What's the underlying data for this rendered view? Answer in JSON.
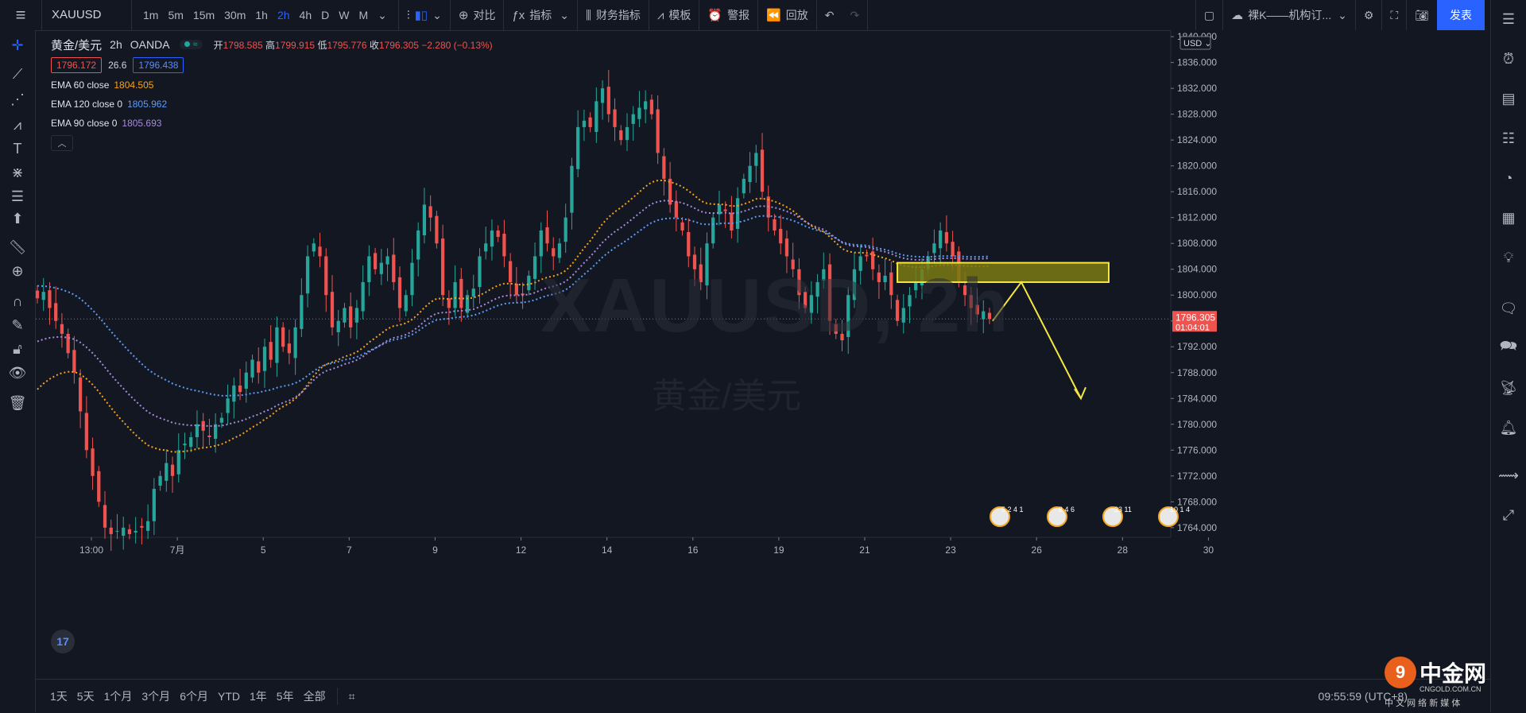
{
  "topbar": {
    "symbol": "XAUUSD",
    "intervals": [
      "1m",
      "5m",
      "15m",
      "30m",
      "1h",
      "2h",
      "4h",
      "D",
      "W",
      "M"
    ],
    "active_interval": "2h",
    "compare_label": "对比",
    "indicators_label": "指标",
    "financials_label": "财务指标",
    "template_label": "模板",
    "alert_label": "警报",
    "replay_label": "回放",
    "layout_name": "裸K——机构订...",
    "publish_label": "发表"
  },
  "legend": {
    "symbol_name": "黄金/美元",
    "interval": "2h",
    "source": "OANDA",
    "open_label": "开",
    "open": "1798.585",
    "high_label": "高",
    "high": "1799.915",
    "low_label": "低",
    "low": "1795.776",
    "close_label": "收",
    "close": "1796.305",
    "change": "−2.280 (−0.13%)",
    "bid": "1796.172",
    "spread": "26.6",
    "ask": "1796.438",
    "emas": [
      {
        "label": "EMA 60 close",
        "value": "1804.505",
        "color": "#f7a21b"
      },
      {
        "label": "EMA 120 close 0",
        "value": "1805.962",
        "color": "#5b9cf6"
      },
      {
        "label": "EMA 90 close 0",
        "value": "1805.693",
        "color": "#a78bdb"
      }
    ]
  },
  "watermark": {
    "ticker": "XAUUSD, 2h",
    "name": "黄金/美元"
  },
  "bottombar": {
    "ranges": [
      "1天",
      "5天",
      "1个月",
      "3个月",
      "6个月",
      "YTD",
      "1年",
      "5年",
      "全部"
    ],
    "clock": "09:55:59 (UTC+8)"
  },
  "brand": {
    "name": "中金网",
    "url": "CNGOLD.COM.CN",
    "tagline": "中 文 网 络 新 媒 体"
  },
  "colors": {
    "up": "#26a69a",
    "down": "#ef5350",
    "bg": "#131722",
    "zone": "#7a7a12",
    "arrow": "#f5e642"
  },
  "chart_data": {
    "type": "candlestick",
    "title": "XAUUSD, 2h",
    "y_axis": {
      "currency": "USD",
      "ylim": [
        1762.5,
        1841
      ],
      "ticks": [
        "1764.000",
        "1768.000",
        "1772.000",
        "1776.000",
        "1780.000",
        "1784.000",
        "1788.000",
        "1792.000",
        "1796.000",
        "1800.000",
        "1804.000",
        "1808.000",
        "1812.000",
        "1816.000",
        "1820.000",
        "1824.000",
        "1828.000",
        "1832.000",
        "1836.000",
        "1840.000"
      ]
    },
    "x_axis": {
      "labels": [
        "13:00",
        "7月",
        "5",
        "7",
        "9",
        "12",
        "14",
        "16",
        "19",
        "21",
        "23",
        "26",
        "28",
        "30"
      ]
    },
    "last_price": {
      "value": "1796.305",
      "countdown": "01:04:01"
    },
    "candle_closes": [
      1799.5,
      1800.5,
      1798,
      1796,
      1794,
      1791,
      1788,
      1782,
      1776,
      1772,
      1768,
      1764,
      1763,
      1763.5,
      1764,
      1763,
      1763.5,
      1764,
      1765,
      1770,
      1772,
      1774,
      1772,
      1776,
      1777,
      1778,
      1780,
      1779,
      1778,
      1780,
      1781,
      1784,
      1786,
      1785,
      1788,
      1790,
      1788,
      1792,
      1790,
      1795,
      1792,
      1791,
      1795,
      1800,
      1806,
      1808,
      1806,
      1800,
      1795,
      1796,
      1798,
      1795,
      1798,
      1802,
      1806,
      1804,
      1805,
      1806,
      1802,
      1798,
      1800,
      1805,
      1810,
      1814,
      1812,
      1808,
      1800,
      1798,
      1802,
      1798,
      1800,
      1801,
      1806,
      1808,
      1810,
      1809,
      1806,
      1802,
      1800,
      1800,
      1803,
      1806,
      1810,
      1808,
      1806,
      1808,
      1812,
      1820,
      1826,
      1827,
      1826,
      1830,
      1832,
      1828,
      1826,
      1824,
      1826,
      1828,
      1829,
      1830,
      1828,
      1822,
      1818,
      1814,
      1812,
      1810,
      1806,
      1804,
      1802,
      1808,
      1812,
      1814,
      1813,
      1810,
      1815,
      1818,
      1820,
      1822,
      1816,
      1812,
      1810,
      1808,
      1806,
      1804,
      1800,
      1798,
      1800,
      1802,
      1804,
      1796,
      1794,
      1793,
      1800,
      1804,
      1806,
      1806,
      1804,
      1802,
      1803,
      1800,
      1796,
      1798,
      1800,
      1802,
      1804,
      1806,
      1808,
      1810,
      1808,
      1806,
      1802,
      1800,
      1798,
      1797,
      1797.5,
      1796.3
    ],
    "emas": [
      {
        "name": "EMA 60 close",
        "color": "#f7a21b",
        "ends": [
          1784.5,
          1804.5
        ]
      },
      {
        "name": "EMA 120 close 0",
        "color": "#5b9cf6",
        "ends": [
          1801.5,
          1806
        ]
      },
      {
        "name": "EMA 90 close 0",
        "color": "#a78bdb",
        "ends": [
          1792.5,
          1805.7
        ]
      }
    ],
    "annotations": [
      {
        "type": "rectangle",
        "y_range": [
          1802,
          1805
        ],
        "color": "#7a7a12",
        "border": "#f5e642"
      },
      {
        "type": "arrow",
        "points": [
          [
            1796,
            0
          ],
          [
            1802,
            1
          ],
          [
            1784,
            2
          ]
        ],
        "color": "#f5e642"
      }
    ],
    "event_markers": [
      "5 2 4 1",
      "8 4 6",
      "33 11",
      "10 1 4"
    ]
  }
}
